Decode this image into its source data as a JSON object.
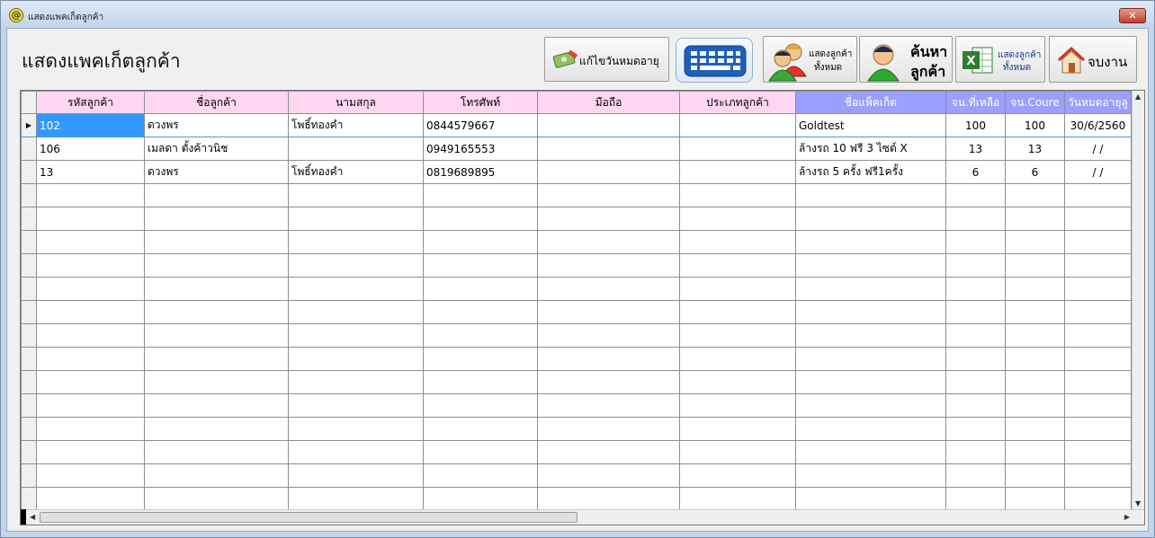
{
  "window": {
    "title": "แสดงแพคเก็ตลูกค้า",
    "close_label": "✕"
  },
  "page": {
    "heading": "แสดงแพคเก็ตลูกค้า"
  },
  "toolbar": {
    "edit_expiry_label": "แก้ไขวันหมดอายุ",
    "keyboard_label": "",
    "show_all_customers_label_line1": "แสดงลูกค้า",
    "show_all_customers_label_line2": "ทั้งหมด",
    "search_customer_label_line1": "ค้นหา",
    "search_customer_label_line2": "ลูกค้า",
    "export_excel_label_line1": "แสดงลูกค้า",
    "export_excel_label_line2": "ทั้งหมด",
    "exit_label": "จบงาน"
  },
  "grid": {
    "columns": [
      "รหัสลูกค้า",
      "ชื่อลูกค้า",
      "นามสกุล",
      "โทรศัพท์",
      "มือถือ",
      "ประเภทลูกค้า",
      "ชื่อแพ็คเก็ต",
      "จน.ที่เหลือ",
      "จน.Coure",
      "วันหมดอายุลู"
    ],
    "rows": [
      [
        "102",
        "ดวงพร",
        "โพธิ์ทองคำ",
        "0844579667",
        "",
        "",
        "Goldtest",
        "100",
        "100",
        "30/6/2560"
      ],
      [
        "106",
        "เมลดา ตั้งค้าวนิช",
        "",
        "0949165553",
        "",
        "",
        "ล้างรถ 10 ฟรี 3 ไซต์ X",
        "13",
        "13",
        "/ /"
      ],
      [
        "13",
        "ดวงพร",
        "โพธิ์ทองคำ",
        "0819689895",
        "",
        "",
        "ล้างรถ 5 ครั้ง ฟรี1ครั้ง",
        "6",
        "6",
        "/ /"
      ]
    ],
    "current_row_marker": "▶",
    "empty_row_count": 14
  },
  "colors": {
    "header_pink": "#ffd7f3",
    "header_blue": "#9b9fff",
    "selection_blue": "#3399ff"
  },
  "icons": [
    "app-icon",
    "close-icon",
    "money-edit-icon",
    "keyboard-icon",
    "users-icon",
    "user-search-icon",
    "excel-icon",
    "home-icon"
  ]
}
